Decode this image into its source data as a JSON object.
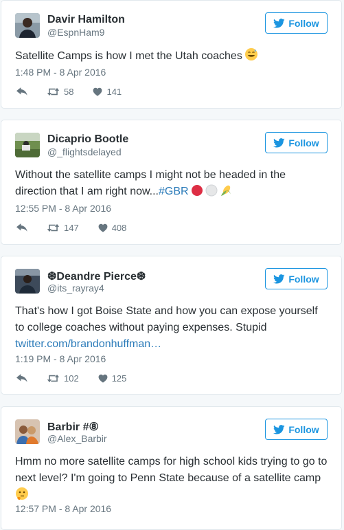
{
  "follow_label": "Follow",
  "tweets": [
    {
      "name": "Davir Hamilton",
      "handle": "@EspnHam9",
      "text": "Satellite Camps is how I met the Utah coaches",
      "timestamp": "1:48 PM - 8 Apr 2016",
      "retweets": "58",
      "likes": "141"
    },
    {
      "name": "Dicaprio Bootle",
      "handle": "@_flightsdelayed",
      "text_line1": "Without the satellite camps I might not be headed in the",
      "text_line2": "direction that I am right now...",
      "hashtag": "#GBR",
      "timestamp": "12:55 PM - 8 Apr 2016",
      "retweets": "147",
      "likes": "408"
    },
    {
      "name": "❆Deandre Pierce❆",
      "handle": "@its_rayray4",
      "text_line1": "That's how I got Boise State and how you can expose yourself",
      "text_line2": "to college coaches without paying expenses. Stupid",
      "link": "twitter.com/brandonhuffman…",
      "timestamp": "1:19 PM - 8 Apr 2016",
      "retweets": "102",
      "likes": "125"
    },
    {
      "name": "Barbir #⑧",
      "handle": "@Alex_Barbir",
      "text_line1": "Hmm no more satellite camps for high school kids trying to go to",
      "text_line2": "next level? I'm going to Penn State because of a satellite camp",
      "timestamp": "12:57 PM - 8 Apr 2016"
    }
  ],
  "colors": {
    "background": "#f5f8fa",
    "card": "#ffffff",
    "accent": "#1b95e0",
    "link": "#2b7bb9",
    "muted": "#66757f",
    "text": "#292f33"
  }
}
